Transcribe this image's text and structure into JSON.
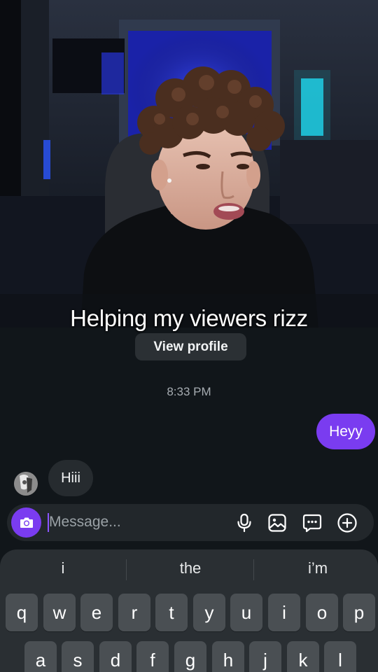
{
  "video": {
    "caption": "Helping my viewers rizz"
  },
  "profile": {
    "view_profile_label": "View profile"
  },
  "chat": {
    "timestamp": "8:33 PM",
    "messages": [
      {
        "direction": "outgoing",
        "text": "Heyy"
      },
      {
        "direction": "incoming",
        "text": "Hiii"
      }
    ]
  },
  "composer": {
    "placeholder": "Message...",
    "icons": [
      "camera-icon",
      "microphone-icon",
      "gallery-icon",
      "sticker-chat-icon",
      "add-icon"
    ]
  },
  "keyboard": {
    "suggestions": [
      "i",
      "the",
      "i’m"
    ],
    "row1": [
      "q",
      "w",
      "e",
      "r",
      "t",
      "y",
      "u",
      "i",
      "o",
      "p"
    ],
    "row2": [
      "a",
      "s",
      "d",
      "f",
      "g",
      "h",
      "j",
      "k",
      "l"
    ]
  },
  "colors": {
    "accent": "#7a3cf0",
    "background": "#11161a",
    "bubble_in": "#262b2f",
    "keyboard": "#2a2f33",
    "key": "#4a4f53"
  }
}
